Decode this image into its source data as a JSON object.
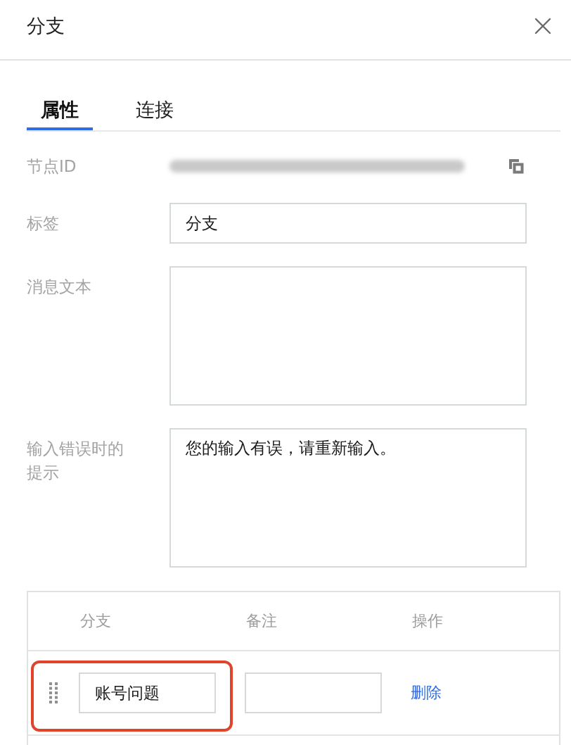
{
  "panel": {
    "title": "分支"
  },
  "tabs": [
    {
      "label": "属性",
      "selected": true
    },
    {
      "label": "连接",
      "selected": false
    }
  ],
  "fields": [
    {
      "kind": "id",
      "label": "节点ID",
      "value_blurred": true
    },
    {
      "kind": "input",
      "label": "标签",
      "value": "分支"
    },
    {
      "kind": "textarea",
      "label": "消息文本"
    },
    {
      "kind": "textarea",
      "label": "输入错误时的提示",
      "value": "您的输入有误，请重新输入。"
    }
  ],
  "branch_table": {
    "columns": [
      "分支",
      "备注",
      "操作"
    ],
    "rows": [
      {
        "branch": "账号问题",
        "action": "删除",
        "highlighted": true
      }
    ]
  }
}
